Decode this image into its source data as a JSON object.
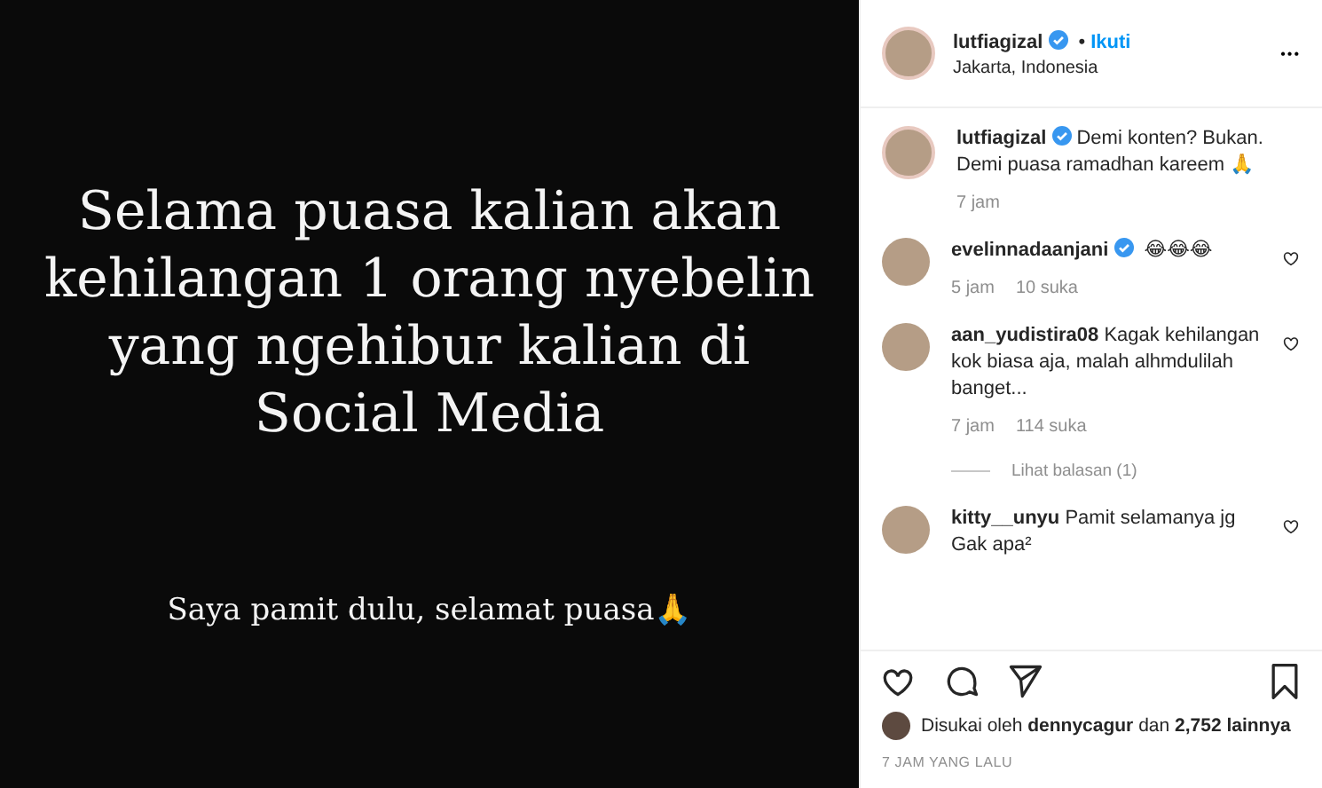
{
  "post_image": {
    "headline_lines": [
      "Selama puasa kalian akan",
      "kehilangan 1 orang nyebelin",
      "yang ngehibur kalian di",
      "Social Media"
    ],
    "footer": "Saya pamit dulu, selamat puasa🙏"
  },
  "header": {
    "username": "lutfiagizal",
    "verified": true,
    "separator": "•",
    "follow": "Ikuti",
    "location": "Jakarta, Indonesia",
    "more": "•••"
  },
  "caption": {
    "username": "lutfiagizal",
    "verified": true,
    "text": "Demi konten? Bukan. Demi puasa ramadhan kareem 🙏",
    "time": "7 jam"
  },
  "comments": [
    {
      "username": "evelinnadaanjani",
      "verified": true,
      "text": "😂😂😂",
      "time": "5 jam",
      "likes": "10 suka"
    },
    {
      "username": "aan_yudistira08",
      "verified": false,
      "text": "Kagak kehilangan kok biasa aja, malah alhmdulilah banget...",
      "time": "7 jam",
      "likes": "114 suka",
      "replies": "Lihat balasan (1)"
    },
    {
      "username": "kitty__unyu",
      "verified": false,
      "text": "Pamit selamanya jg Gak apa²"
    }
  ],
  "likes": {
    "prefix": "Disukai oleh",
    "user": "dennycagur",
    "middle": "dan",
    "count": "2,752 lainnya"
  },
  "timestamp": "7 JAM YANG LALU"
}
